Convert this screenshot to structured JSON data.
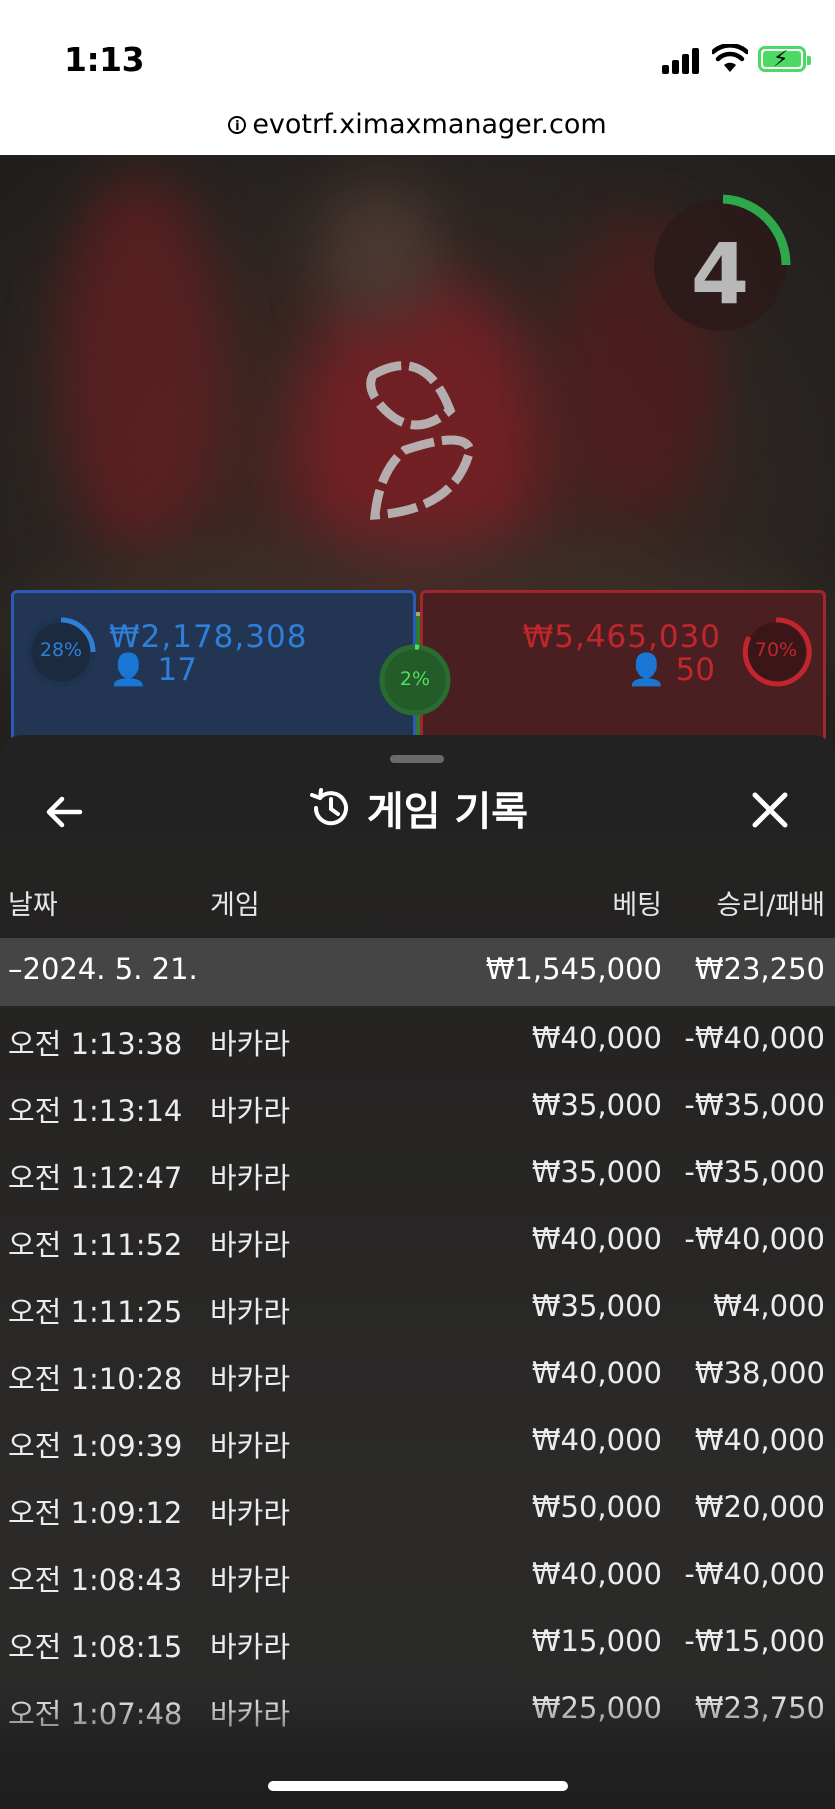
{
  "status_bar": {
    "time": "1:13"
  },
  "browser": {
    "url": "evotrf.ximaxmanager.com"
  },
  "video": {
    "countdown": "4"
  },
  "bet_panels": {
    "player": {
      "percent": "28%",
      "amount": "₩2,178,308",
      "players": "17",
      "color": "#2f7ed8"
    },
    "banker": {
      "percent": "70%",
      "amount": "₩5,465,030",
      "players": "50",
      "color": "#c0262c"
    },
    "tie": {
      "percent": "2%",
      "color": "#2fb43d"
    }
  },
  "history": {
    "title": "게임 기록",
    "columns": {
      "date": "날짜",
      "game": "게임",
      "bet": "베팅",
      "win_loss": "승리/패배"
    },
    "summary": {
      "date": "–2024. 5. 21.",
      "bet": "₩1,545,000",
      "win_loss": "₩23,250"
    },
    "rows": [
      {
        "time": "오전 1:13:38",
        "game": "바카라",
        "bet": "₩40,000",
        "result": "-₩40,000"
      },
      {
        "time": "오전 1:13:14",
        "game": "바카라",
        "bet": "₩35,000",
        "result": "-₩35,000"
      },
      {
        "time": "오전 1:12:47",
        "game": "바카라",
        "bet": "₩35,000",
        "result": "-₩35,000"
      },
      {
        "time": "오전 1:11:52",
        "game": "바카라",
        "bet": "₩40,000",
        "result": "-₩40,000"
      },
      {
        "time": "오전 1:11:25",
        "game": "바카라",
        "bet": "₩35,000",
        "result": "₩4,000"
      },
      {
        "time": "오전 1:10:28",
        "game": "바카라",
        "bet": "₩40,000",
        "result": "₩38,000"
      },
      {
        "time": "오전 1:09:39",
        "game": "바카라",
        "bet": "₩40,000",
        "result": "₩40,000"
      },
      {
        "time": "오전 1:09:12",
        "game": "바카라",
        "bet": "₩50,000",
        "result": "₩20,000"
      },
      {
        "time": "오전 1:08:43",
        "game": "바카라",
        "bet": "₩40,000",
        "result": "-₩40,000"
      },
      {
        "time": "오전 1:08:15",
        "game": "바카라",
        "bet": "₩15,000",
        "result": "-₩15,000"
      },
      {
        "time": "오전 1:07:48",
        "game": "바카라",
        "bet": "₩25,000",
        "result": "₩23,750"
      }
    ]
  }
}
